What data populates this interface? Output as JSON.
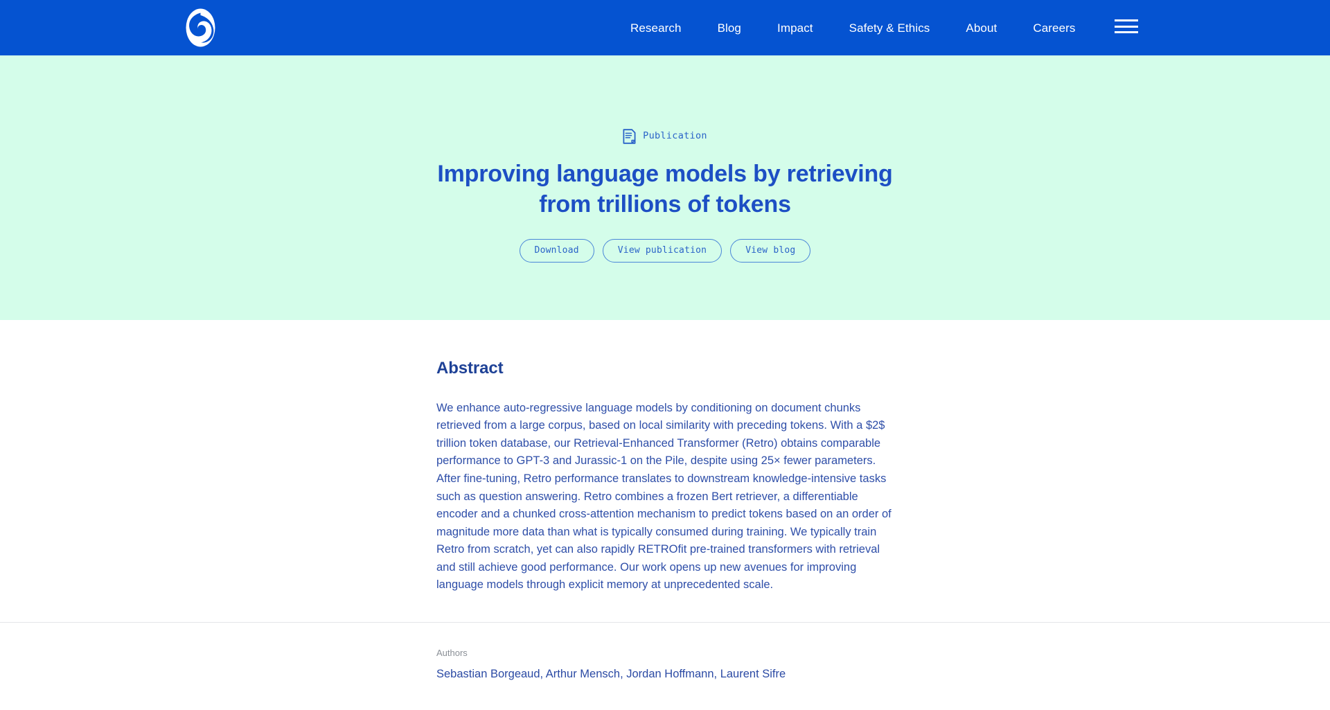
{
  "theme": {
    "nav_background": "#0553d1",
    "hero_background": "#d4fdea",
    "page_background": "#ffffff",
    "primary_blue": "#1d4fc4",
    "heading_blue": "#1e4196",
    "body_blue": "#2e4ea8",
    "accent_blue": "#2a63c8",
    "button_border": "#4a86d8",
    "divider": "#e4e6e9",
    "muted_text": "#8a8f96"
  },
  "nav": {
    "logo_icon": "spiral-logo-icon",
    "links": [
      {
        "label": "Research"
      },
      {
        "label": "Blog"
      },
      {
        "label": "Impact"
      },
      {
        "label": "Safety & Ethics"
      },
      {
        "label": "About"
      },
      {
        "label": "Careers"
      }
    ],
    "menu_icon": "hamburger-menu-icon"
  },
  "hero": {
    "eyebrow_icon": "document-icon",
    "eyebrow_label": "Publication",
    "title": "Improving language models by retrieving from trillions of tokens",
    "actions": [
      {
        "label": "Download"
      },
      {
        "label": "View publication"
      },
      {
        "label": "View blog"
      }
    ]
  },
  "main": {
    "abstract_heading": "Abstract",
    "abstract_text": "We enhance auto-regressive language models by conditioning on document chunks retrieved from a large corpus, based on local similarity with preceding tokens. With a $2$ trillion token database, our Retrieval-Enhanced Transformer (Retro) obtains comparable performance to GPT-3 and Jurassic-1 on the Pile, despite using 25× fewer parameters. After fine-tuning, Retro performance translates to downstream knowledge-intensive tasks such as question answering. Retro combines a frozen Bert retriever, a differentiable encoder and a chunked cross-attention mechanism to predict tokens based on an order of magnitude more data than what is typically consumed during training. We typically train Retro from scratch, yet can also rapidly RETROfit pre-trained transformers with retrieval and still achieve good performance. Our work opens up new avenues for improving language models through explicit memory at unprecedented scale.",
    "authors_label": "Authors",
    "authors_names": "Sebastian Borgeaud, Arthur Mensch, Jordan Hoffmann, Laurent Sifre"
  }
}
